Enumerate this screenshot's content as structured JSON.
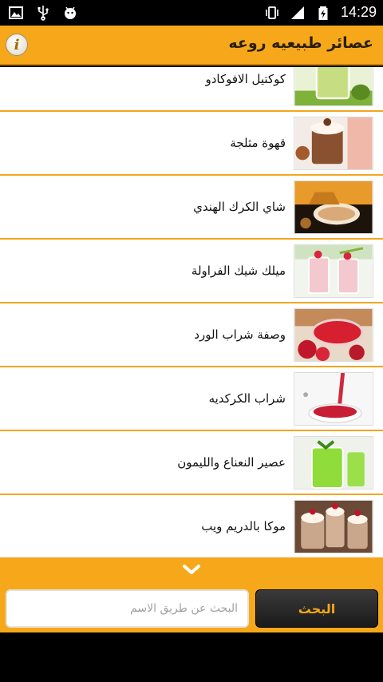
{
  "status_bar": {
    "time": "14:29",
    "icons": [
      "image-icon",
      "usb-icon",
      "android-debug-icon",
      "vibrate-icon",
      "signal-icon",
      "battery-charging-icon"
    ]
  },
  "header": {
    "title": "عصائر طبيعيه روعه",
    "info_icon": "info-icon"
  },
  "items": [
    {
      "label": "كوكتيل الافوكادو",
      "thumb": "avocado"
    },
    {
      "label": "قهوة مثلجة",
      "thumb": "iced-coffee"
    },
    {
      "label": "شاي الكرك الهندي",
      "thumb": "karak-tea"
    },
    {
      "label": "ميلك شيك الفراولة",
      "thumb": "strawberry-milkshake"
    },
    {
      "label": "وصفة شراب الورد",
      "thumb": "rose-drink"
    },
    {
      "label": "شراب الكركديه",
      "thumb": "hibiscus"
    },
    {
      "label": "عصير النعناع والليمون",
      "thumb": "mint-lemon"
    },
    {
      "label": "موكا بالدريم ويب",
      "thumb": "mocha"
    }
  ],
  "footer": {
    "expand_icon": "chevron-down-icon",
    "search_placeholder": "البحث عن طريق الاسم",
    "search_value": "",
    "search_button": "البحث"
  },
  "colors": {
    "accent": "#f6a81a",
    "divider": "#f5a51c",
    "button_dark": "#1a1a1a"
  }
}
